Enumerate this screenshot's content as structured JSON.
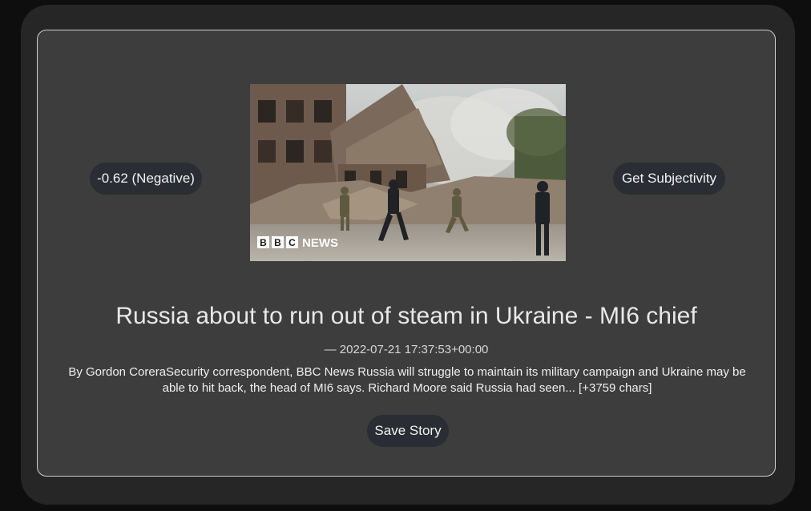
{
  "sentiment": {
    "label": "-0.62 (Negative)"
  },
  "subjectivity_button": {
    "label": "Get Subjectivity"
  },
  "image": {
    "watermark_letters": [
      "B",
      "B",
      "C"
    ],
    "watermark_word": "NEWS"
  },
  "story": {
    "title": "Russia about to run out of steam in Ukraine - MI6 chief",
    "date": "— 2022-07-21 17:37:53+00:00",
    "body": "By Gordon CoreraSecurity correspondent, BBC News Russia will struggle to maintain its military campaign and Ukraine may be able to hit back, the head of MI6 says. Richard Moore said Russia had seen... [+3759 chars]"
  },
  "save_button": {
    "label": "Save Story"
  },
  "colors": {
    "page_background": "#0e0e0e",
    "outer_panel": "#262626",
    "card_background": "#3d3d3d",
    "card_border": "#cfcfcf",
    "pill_background": "#2a2d33",
    "text": "#e8e8e8"
  }
}
